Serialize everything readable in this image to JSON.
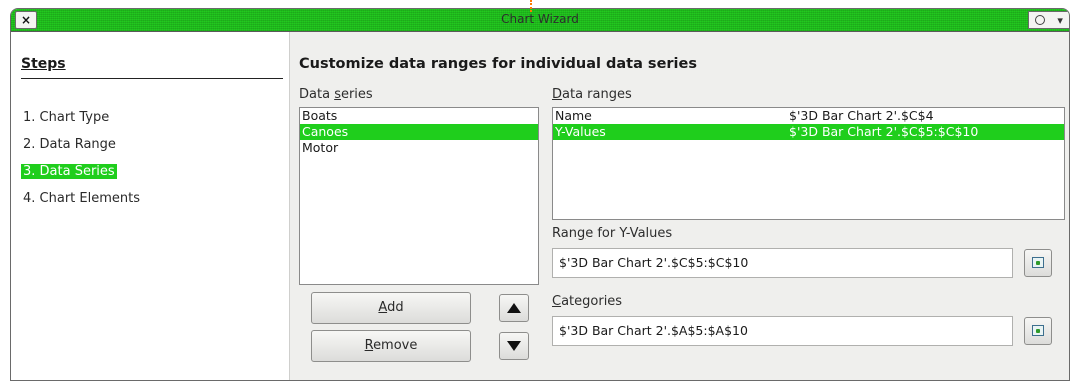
{
  "window": {
    "title": "Chart Wizard",
    "close_glyph": "×",
    "menu_glyph": "▾"
  },
  "steps": {
    "title": "Steps",
    "items": [
      {
        "label": "1. Chart Type",
        "active": false
      },
      {
        "label": "2. Data Range",
        "active": false
      },
      {
        "label": "3. Data Series",
        "active": true
      },
      {
        "label": "4. Chart Elements",
        "active": false
      }
    ]
  },
  "main": {
    "heading": "Customize data ranges for individual data series",
    "data_series": {
      "label_pre": "Data ",
      "label_u": "s",
      "label_post": "eries",
      "items": [
        {
          "label": "Boats",
          "selected": false
        },
        {
          "label": "Canoes",
          "selected": true
        },
        {
          "label": "Motor",
          "selected": false
        }
      ]
    },
    "data_ranges": {
      "label_u": "D",
      "label_post": "ata ranges",
      "rows": [
        {
          "role": "Name",
          "range": "$'3D Bar Chart 2'.$C$4",
          "selected": false
        },
        {
          "role": "Y-Values",
          "range": "$'3D Bar Chart 2'.$C$5:$C$10",
          "selected": true
        }
      ]
    },
    "range_for": {
      "label_pre": "Ran",
      "label_u": "g",
      "label_post": "e for Y-Values",
      "value": "$'3D Bar Chart 2'.$C$5:$C$10"
    },
    "categories": {
      "label_u": "C",
      "label_post": "ategories",
      "value": "$'3D Bar Chart 2'.$A$5:$A$10"
    },
    "buttons": {
      "add_u": "A",
      "add_post": "dd",
      "remove_u": "R",
      "remove_post": "emove"
    }
  },
  "colors": {
    "selection": "#1fce1c",
    "titlebar": "#22c91f"
  }
}
